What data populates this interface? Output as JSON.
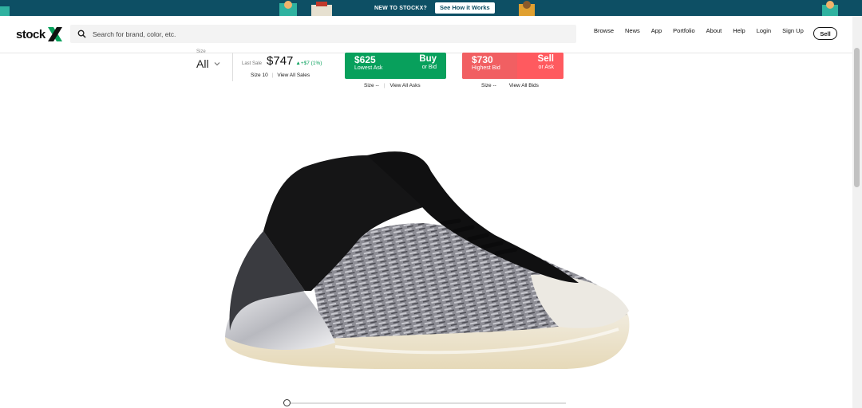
{
  "banner": {
    "text": "NEW TO STOCKX?",
    "button_label": "See How it Works"
  },
  "header": {
    "logo_text": "stock",
    "search_placeholder": "Search for brand, color, etc.",
    "nav": [
      "Browse",
      "News",
      "App",
      "Portfolio",
      "About",
      "Help",
      "Login",
      "Sign Up"
    ],
    "sell_label": "Sell"
  },
  "market": {
    "size_label": "Size",
    "size_value": "All",
    "last_sale_label": "Last Sale",
    "last_sale_price": "$747",
    "last_sale_change": "▲+$7 (1%)",
    "last_sale_size": "Size 10",
    "view_all_sales": "View All Sales",
    "lowest_ask": {
      "price": "$625",
      "label": "Lowest Ask",
      "action": "Buy",
      "action_sub": "or Bid",
      "size_text": "Size --",
      "link": "View All Asks"
    },
    "highest_bid": {
      "price": "$730",
      "label": "Highest Bid",
      "action": "Sell",
      "action_sub": "or Ask",
      "size_text": "Size --",
      "link": "View All Bids"
    }
  },
  "colors": {
    "banner_bg": "#0d4f64",
    "ask_green": "#08a05c",
    "bid_red": "#ff5a5f",
    "logo_green": "#08a05c"
  },
  "slider": {
    "position": 0
  }
}
